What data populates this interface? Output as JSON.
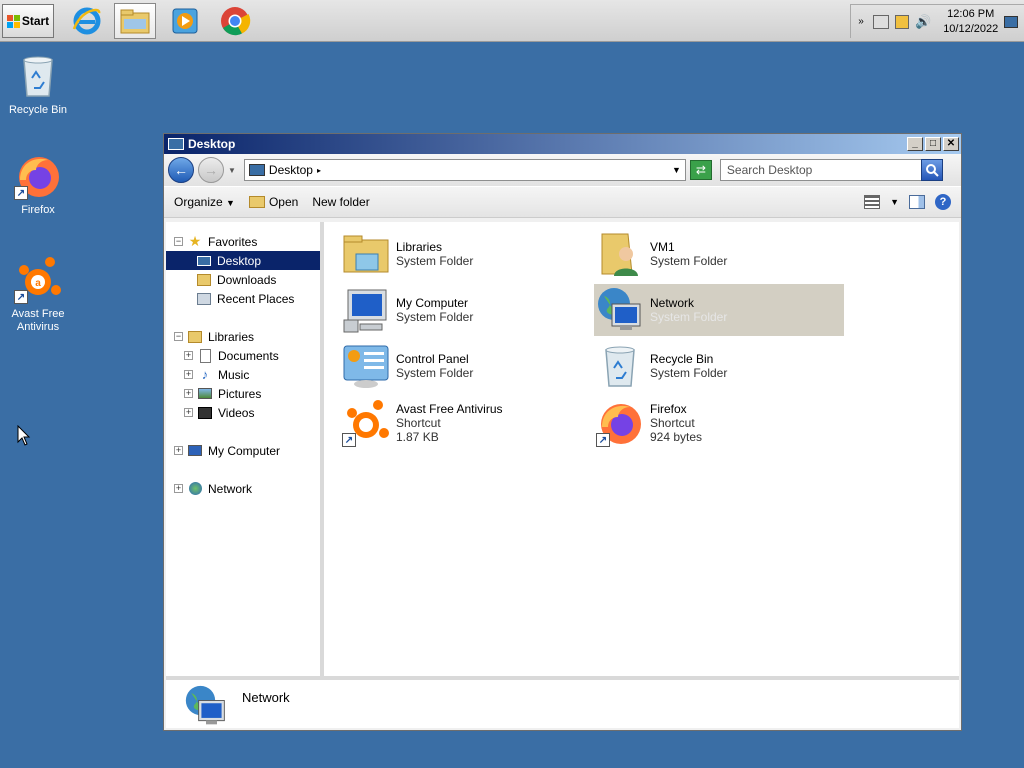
{
  "taskbar": {
    "start_label": "Start",
    "apps": [
      {
        "name": "internet-explorer"
      },
      {
        "name": "windows-explorer",
        "active": true
      },
      {
        "name": "media-player"
      },
      {
        "name": "chrome"
      }
    ],
    "clock": {
      "time": "12:06 PM",
      "date": "10/12/2022"
    }
  },
  "desktop_icons": [
    {
      "label": "Recycle Bin",
      "icon": "recycle-bin-icon"
    },
    {
      "label": "Firefox",
      "icon": "firefox-icon"
    },
    {
      "label": "Avast Free Antivirus",
      "icon": "avast-icon"
    }
  ],
  "window": {
    "title": "Desktop",
    "address": "Desktop",
    "search_placeholder": "Search Desktop",
    "toolbar": {
      "organize": "Organize",
      "open": "Open",
      "new_folder": "New folder"
    },
    "nav": {
      "favorites": "Favorites",
      "desktop": "Desktop",
      "downloads": "Downloads",
      "recent_places": "Recent Places",
      "libraries": "Libraries",
      "documents": "Documents",
      "music": "Music",
      "pictures": "Pictures",
      "videos": "Videos",
      "my_computer": "My Computer",
      "network": "Network"
    },
    "items": [
      {
        "name": "Libraries",
        "line2": "System Folder",
        "line3": ""
      },
      {
        "name": "VM1",
        "line2": "System Folder",
        "line3": ""
      },
      {
        "name": "My Computer",
        "line2": "System Folder",
        "line3": ""
      },
      {
        "name": "Network",
        "line2": "System Folder",
        "line3": ""
      },
      {
        "name": "Control Panel",
        "line2": "System Folder",
        "line3": ""
      },
      {
        "name": "Recycle Bin",
        "line2": "System Folder",
        "line3": ""
      },
      {
        "name": "Avast Free Antivirus",
        "line2": "Shortcut",
        "line3": "1.87 KB"
      },
      {
        "name": "Firefox",
        "line2": "Shortcut",
        "line3": "924 bytes"
      }
    ],
    "details": {
      "name": "Network"
    }
  },
  "colors": {
    "desktop": "#3a6ea5",
    "titlebar": "#0a246a",
    "selection": "#d3cfc3"
  }
}
